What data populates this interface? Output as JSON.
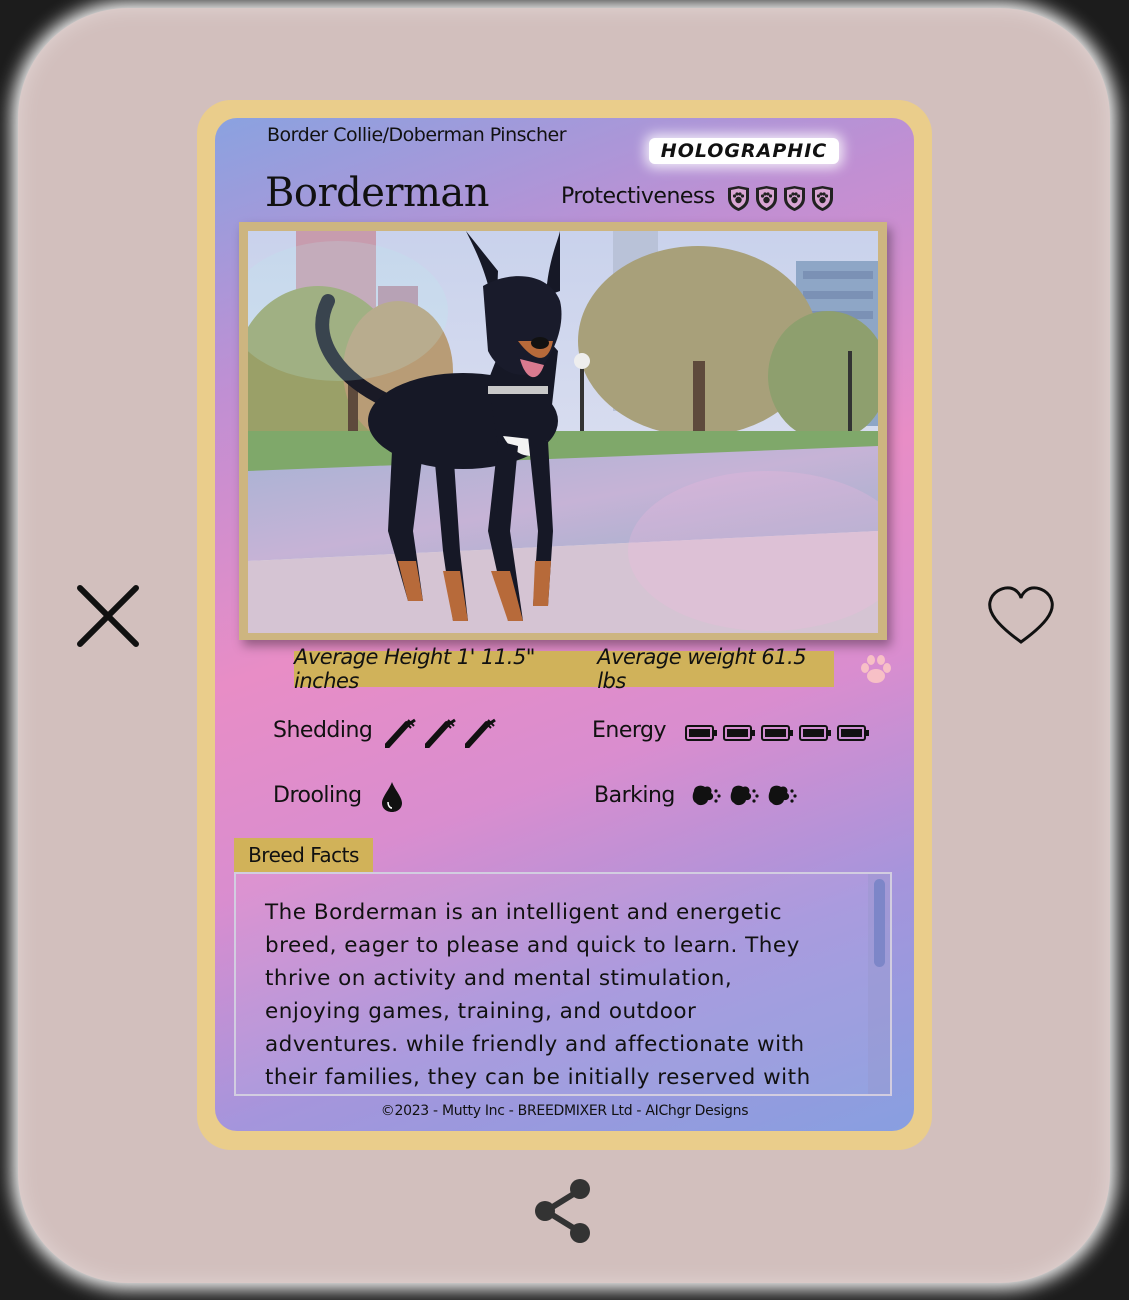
{
  "card": {
    "breed_sub": "Border Collie/Doberman Pinscher",
    "badge": "HOLOGRAPHIC",
    "breed_title": "Borderman",
    "protectiveness": {
      "label": "Protectiveness",
      "level": 4,
      "max": 4,
      "icon": "shield-paw-icon"
    },
    "photo": {
      "alt": "Black and tan dog standing on a city sidewalk"
    },
    "stats": {
      "height": "Average Height 1' 11.5\" inches",
      "weight": "Average weight 61.5 lbs"
    },
    "traits": {
      "shedding": {
        "label": "Shedding",
        "level": 3,
        "icon": "comb-icon"
      },
      "energy": {
        "label": "Energy",
        "level": 5,
        "icon": "battery-icon"
      },
      "drooling": {
        "label": "Drooling",
        "level": 1,
        "icon": "droplet-icon"
      },
      "barking": {
        "label": "Barking",
        "level": 3,
        "icon": "barking-dog-icon"
      }
    },
    "facts": {
      "tab_label": "Breed Facts",
      "text": "The Borderman is an intelligent and energetic breed, eager to please and quick to learn. They thrive on activity and mental stimulation, enjoying games, training, and outdoor adventures. while friendly and affectionate with their families, they can be initially reserved with strangers. Early"
    },
    "footer": "©2023 - Mutty Inc - BREEDMIXER Ltd - AIChgr Designs"
  },
  "actions": {
    "close_icon": "close-icon",
    "like_icon": "heart-icon",
    "share_icon": "share-icon"
  },
  "colors": {
    "background": "#d2bfbd",
    "card_border": "#eacd8b",
    "gold_bar": "#d0b25a",
    "accent_pink": "#f7c0c6"
  }
}
